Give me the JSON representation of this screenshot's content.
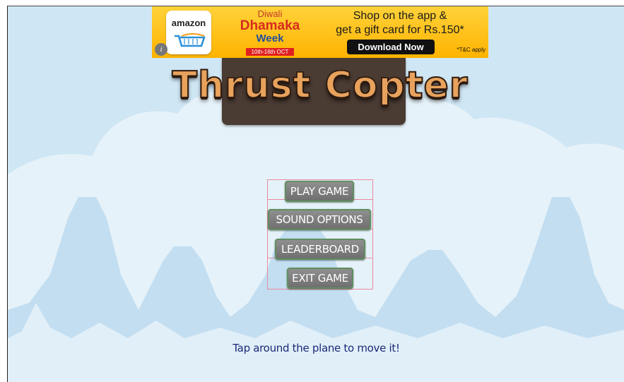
{
  "ad": {
    "logo_text": "amazon",
    "info_glyph": "i",
    "diwali_line1": "Diwali",
    "diwali_line2": "Dhamaka",
    "diwali_line3": "Week",
    "dates": "10th-16th OCT",
    "shop_line1": "Shop on the app &",
    "shop_line2": "get a gift card for Rs.150*",
    "download_label": "Download Now",
    "terms": "*T&C apply"
  },
  "game": {
    "title": "Thrust Copter",
    "menu": [
      {
        "label": "PLAY GAME"
      },
      {
        "label": "SOUND OPTIONS"
      },
      {
        "label": "LEADERBOARD"
      },
      {
        "label": "EXIT GAME"
      }
    ],
    "hint": "Tap around the plane to move it!"
  },
  "colors": {
    "sky": "#cfe6f4",
    "cloud": "#e6f2f9",
    "button": "#7a7a7a",
    "hint_text": "#1b2a78"
  }
}
